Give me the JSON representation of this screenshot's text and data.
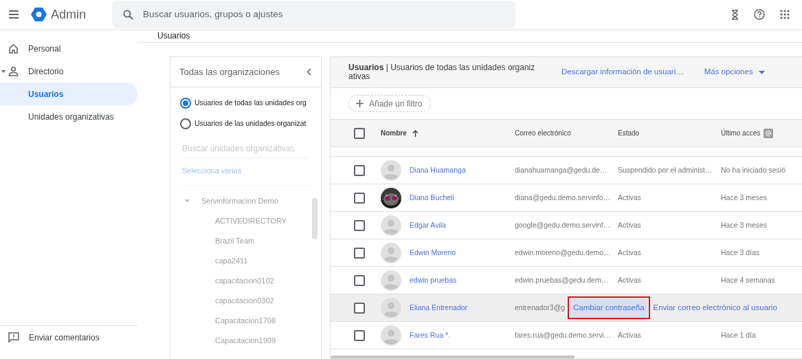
{
  "app": {
    "title": "Admin"
  },
  "search": {
    "placeholder": "Buscar usuarios, grupos o ajustes"
  },
  "breadcrumb": "Usuarios",
  "sidebar": {
    "items": [
      {
        "label": "Personal",
        "selected": false
      },
      {
        "label": "Directorio",
        "selected": false,
        "expanded": true,
        "children": [
          {
            "label": "Usuarios",
            "selected": true
          },
          {
            "label": "Unidades organizativas",
            "selected": false
          }
        ]
      }
    ],
    "feedback": "Enviar comentarios"
  },
  "org_panel": {
    "title": "Todas las organizaciones",
    "options": [
      {
        "label": "Usuarios de todas las unidades org",
        "selected": true
      },
      {
        "label": "Usuarios de las unidades organizat",
        "selected": false
      }
    ],
    "search": {
      "placeholder": "Buscar unidades organizativas"
    },
    "select_many": "Selecciona varias",
    "tree": [
      {
        "label": "Servinformacion Demo",
        "expanded": true,
        "children": [
          {
            "label": "ACTIVEDIRECTORY"
          },
          {
            "label": "Brazil Team"
          },
          {
            "label": "capa2411"
          },
          {
            "label": "capacitacion0102"
          },
          {
            "label": "capacitacion0302"
          },
          {
            "label": "Capacitacion1708"
          },
          {
            "label": "Capacitacion1909"
          }
        ]
      }
    ]
  },
  "users_panel": {
    "title_bold": "Usuarios",
    "title_rest": "| Usuarios de todas las unidades organiz ativas",
    "download": "Descargar información de usuari…",
    "more": "Más opciones",
    "filter": "Añade un filtro",
    "all_checked": false,
    "columns": [
      "Nombre",
      "Correo electrónico",
      "Estado",
      "Último acces"
    ],
    "rows": [
      {
        "kind": "normal",
        "name": "Diana Huamanga",
        "email": "dianahuamanga@gedu.de…",
        "status": "Suspendido por el administ…",
        "last": "No ha iniciado sesió",
        "photo": false,
        "checked": false
      },
      {
        "kind": "normal",
        "name": "Diana Bucheli",
        "email": "diana@gedu.demo.servinfo…",
        "status": "Activas",
        "last": "Hace 3 meses",
        "photo": true,
        "checked": false
      },
      {
        "kind": "normal",
        "name": "Edgar Avila",
        "email": "google@gedu.demo.servinf…",
        "status": "Activas",
        "last": "Hace 3 meses",
        "photo": false,
        "checked": false
      },
      {
        "kind": "normal",
        "name": "Edwin Moreno",
        "email": "edwin.moreno@gedu.demo…",
        "status": "Activas",
        "last": "Hace 3 días",
        "photo": false,
        "checked": false
      },
      {
        "kind": "normal",
        "name": "edwin pruebas",
        "email": "edwin.pruebas@gedu.dem…",
        "status": "Activas",
        "last": "Hace 4 semanas",
        "photo": false,
        "checked": false
      },
      {
        "kind": "hover",
        "name": "Eliana Entrenador",
        "email": "entrenador3@g",
        "photo": false,
        "checked": false,
        "actions": [
          {
            "label": "Cambiar contraseña",
            "selected": true
          },
          {
            "label": "Enviar correo electrónico al usuario",
            "selected": false
          }
        ]
      },
      {
        "kind": "normal",
        "name": "Fares Rua *.",
        "email": "fares.rua@gedu.demo.servi…",
        "status": "Activas",
        "last": "Hace 1 día",
        "photo": false,
        "checked": false
      }
    ]
  }
}
